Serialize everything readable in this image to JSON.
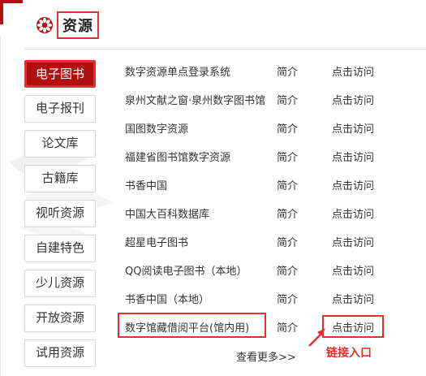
{
  "header": {
    "title": "资源",
    "logo_icon": "flower-logo-icon",
    "accent": "#b01010",
    "highlight": "#e03131"
  },
  "tabs": [
    {
      "label": "电子图书",
      "active": true
    },
    {
      "label": "电子报刊"
    },
    {
      "label": "论文库"
    },
    {
      "label": "古籍库"
    },
    {
      "label": "视听资源"
    },
    {
      "label": "自建特色"
    },
    {
      "label": "少儿资源"
    },
    {
      "label": "开放资源"
    },
    {
      "label": "试用资源"
    }
  ],
  "resources": [
    {
      "name": "数字资源单点登录系统",
      "intro": "简介",
      "visit": "点击访问"
    },
    {
      "name": "泉州文献之窗·泉州数字图书馆",
      "intro": "简介",
      "visit": "点击访问"
    },
    {
      "name": "国图数字资源",
      "intro": "简介",
      "visit": "点击访问"
    },
    {
      "name": "福建省图书馆数字资源",
      "intro": "简介",
      "visit": "点击访问"
    },
    {
      "name": "书香中国",
      "intro": "简介",
      "visit": "点击访问"
    },
    {
      "name": "中国大百科数据库",
      "intro": "简介",
      "visit": "点击访问"
    },
    {
      "name": "超星电子图书",
      "intro": "简介",
      "visit": "点击访问"
    },
    {
      "name": "QQ阅读电子图书（本地）",
      "intro": "简介",
      "visit": "点击访问"
    },
    {
      "name": "书香中国（本地）",
      "intro": "简介",
      "visit": "点击访问"
    },
    {
      "name": "数字馆藏借阅平台(馆内用)",
      "intro": "简介",
      "visit": "点击访问"
    }
  ],
  "more": "查看更多>>",
  "annotation": {
    "label": "链接入口",
    "arrow_icon": "red-arrow-icon"
  }
}
